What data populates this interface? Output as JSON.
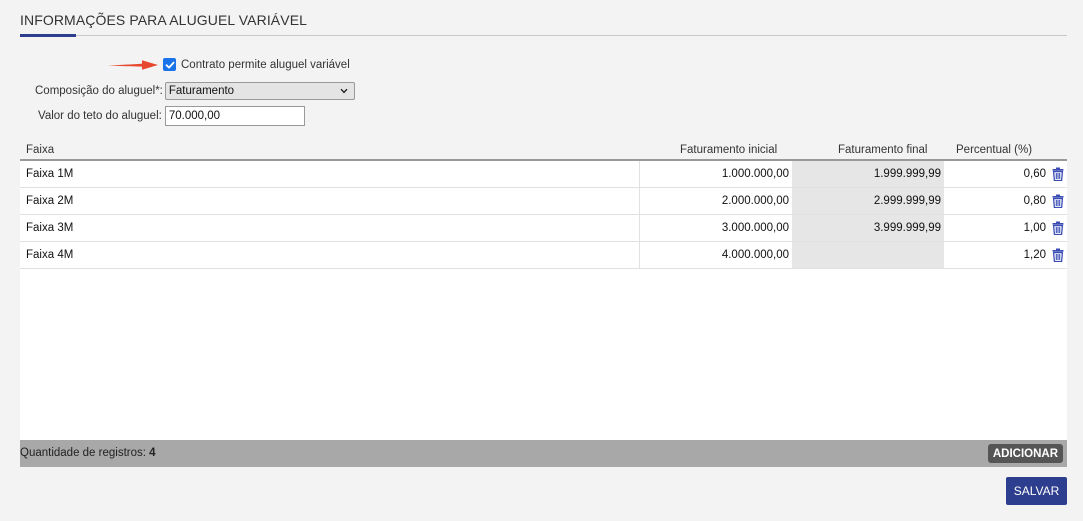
{
  "section": {
    "title": "INFORMAÇÕES PARA ALUGUEL VARIÁVEL"
  },
  "form": {
    "checkbox_label": "Contrato permite aluguel variável",
    "checkbox_checked": true,
    "composition_label": "Composição do aluguel*:",
    "composition_value": "Faturamento",
    "ceiling_label": "Valor do teto do aluguel:",
    "ceiling_value": "70.000,00"
  },
  "grid": {
    "columns": [
      "Faixa",
      "Faturamento inicial",
      "Faturamento final",
      "Percentual (%)"
    ],
    "rows": [
      {
        "faixa": "Faixa 1M",
        "inicial": "1.000.000,00",
        "final": "1.999.999,99",
        "percentual": "0,60"
      },
      {
        "faixa": "Faixa 2M",
        "inicial": "2.000.000,00",
        "final": "2.999.999,99",
        "percentual": "0,80"
      },
      {
        "faixa": "Faixa 3M",
        "inicial": "3.000.000,00",
        "final": "3.999.999,99",
        "percentual": "1,00"
      },
      {
        "faixa": "Faixa 4M",
        "inicial": "4.000.000,00",
        "final": "",
        "percentual": "1,20"
      }
    ],
    "footer_label": "Quantidade de registros:",
    "footer_count": "4",
    "add_button": "ADICIONAR"
  },
  "actions": {
    "save_button": "SALVAR"
  },
  "colors": {
    "accent": "#2d3e8f",
    "checkbox": "#1a73e8",
    "arrow": "#e8472f",
    "trash": "#3b4db5"
  },
  "icons": {
    "row_delete": "trash-icon",
    "select_caret": "chevron-down-icon",
    "pointer": "arrow-icon"
  }
}
